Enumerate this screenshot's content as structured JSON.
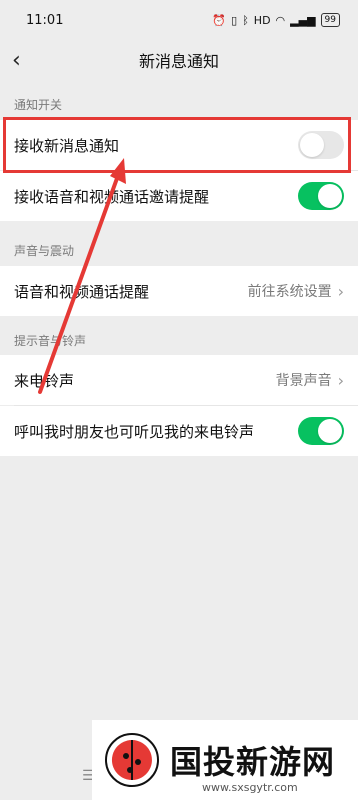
{
  "status_bar": {
    "time": "11:01",
    "battery": "99"
  },
  "nav": {
    "title": "新消息通知",
    "back_icon": "chevron-left-icon"
  },
  "sections": {
    "notify": {
      "label": "通知开关",
      "items": [
        {
          "label": "接收新消息通知",
          "toggle": "off"
        },
        {
          "label": "接收语音和视频通话邀请提醒",
          "toggle": "on"
        }
      ]
    },
    "sound": {
      "label": "声音与震动",
      "items": [
        {
          "label": "语音和视频通话提醒",
          "value": "前往系统设置"
        }
      ]
    },
    "ringtone": {
      "label": "提示音与铃声",
      "items": [
        {
          "label": "来电铃声",
          "value": "背景声音"
        },
        {
          "label": "呼叫我时朋友也可听见我的来电铃声",
          "toggle": "on"
        }
      ]
    }
  },
  "colors": {
    "accent": "#07c160",
    "annotation": "#e53935"
  },
  "watermark": {
    "text": "国投新游网",
    "url": "www.sxsgytr.com"
  }
}
